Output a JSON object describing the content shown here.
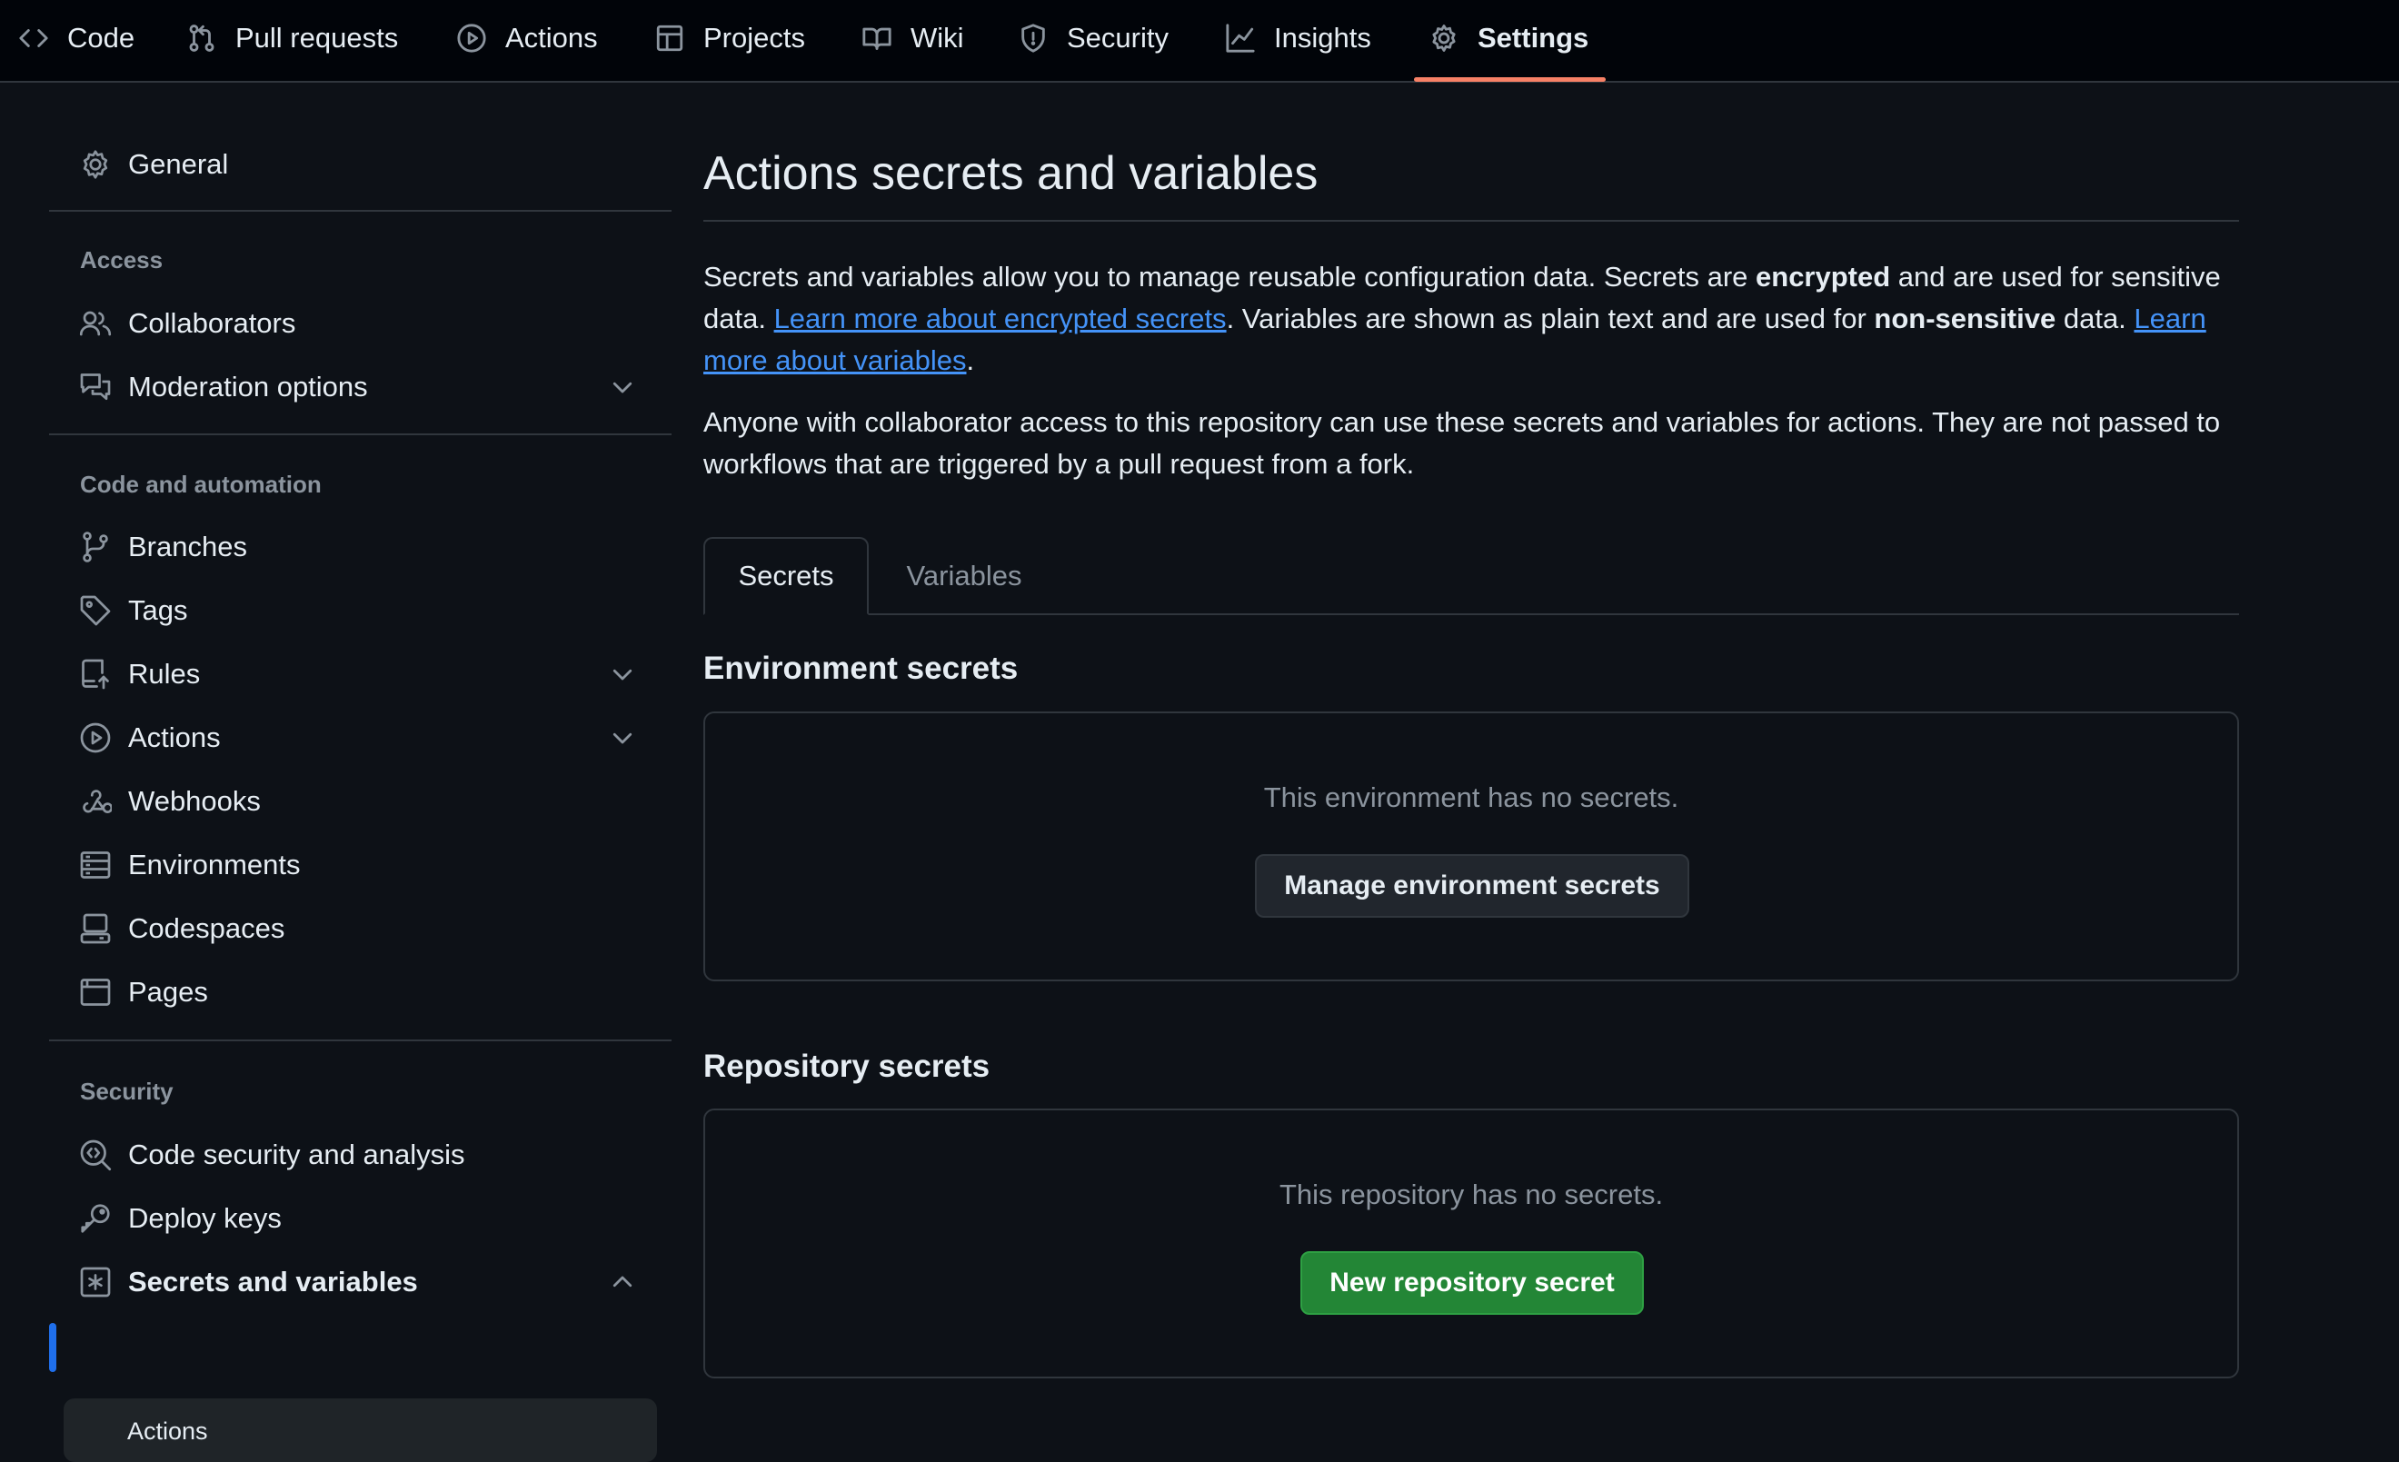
{
  "topnav": {
    "tabs": [
      {
        "label": "Code",
        "icon": "code-icon"
      },
      {
        "label": "Pull requests",
        "icon": "pull-request-icon"
      },
      {
        "label": "Actions",
        "icon": "play-icon"
      },
      {
        "label": "Projects",
        "icon": "table-icon"
      },
      {
        "label": "Wiki",
        "icon": "book-icon"
      },
      {
        "label": "Security",
        "icon": "shield-icon"
      },
      {
        "label": "Insights",
        "icon": "graph-icon"
      },
      {
        "label": "Settings",
        "icon": "gear-icon"
      }
    ],
    "active_tab": "Settings"
  },
  "sidebar": {
    "general": "General",
    "access_heading": "Access",
    "access_items": [
      "Collaborators",
      "Moderation options"
    ],
    "code_heading": "Code and automation",
    "code_items": [
      "Branches",
      "Tags",
      "Rules",
      "Actions",
      "Webhooks",
      "Environments",
      "Codespaces",
      "Pages"
    ],
    "security_heading": "Security",
    "security_items": [
      "Code security and analysis",
      "Deploy keys",
      "Secrets and variables"
    ],
    "sub_items": [
      "Actions"
    ]
  },
  "main": {
    "title": "Actions secrets and variables",
    "intro": {
      "part1": "Secrets and variables allow you to manage reusable configuration data. Secrets are ",
      "bold1": "encrypted",
      "part2": " and are used for sensitive data. ",
      "link1": "Learn more about encrypted secrets",
      "part3": ". Variables are shown as plain text and are used for ",
      "bold2": "non-sensitive",
      "part4": " data. ",
      "link2": "Learn more about variables",
      "part5": "."
    },
    "note": "Anyone with collaborator access to this repository can use these secrets and variables for actions. They are not passed to workflows that are triggered by a pull request from a fork.",
    "tabs": [
      "Secrets",
      "Variables"
    ],
    "env_section": {
      "title": "Environment secrets",
      "empty_text": "This environment has no secrets.",
      "button": "Manage environment secrets"
    },
    "repo_section": {
      "title": "Repository secrets",
      "empty_text": "This repository has no secrets.",
      "button": "New repository secret"
    }
  },
  "colors": {
    "background": "#0d1117",
    "accent_underline": "#f78166",
    "link": "#4493f8",
    "primary_button": "#238636"
  }
}
